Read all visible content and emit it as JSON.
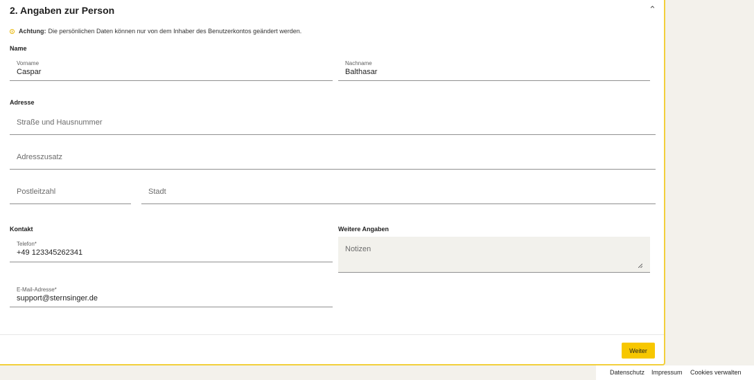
{
  "section": {
    "title": "2. Angaben zur Person",
    "warning_bold": "Achtung:",
    "warning_text": "Die persönlichen Daten können nur von dem Inhaber des Benutzerkontos geändert werden."
  },
  "name": {
    "label": "Name",
    "first_label": "Vorname",
    "first_value": "Caspar",
    "last_label": "Nachname",
    "last_value": "Balthasar"
  },
  "address": {
    "label": "Adresse",
    "street_placeholder": "Straße und Hausnummer",
    "extra_placeholder": "Adresszusatz",
    "zip_placeholder": "Postleitzahl",
    "city_placeholder": "Stadt"
  },
  "contact": {
    "label": "Kontakt",
    "phone_label": "Telefon*",
    "phone_value": "+49 123345262341",
    "email_label": "E-Mail-Adresse*",
    "email_value": "support@sternsinger.de"
  },
  "more": {
    "label": "Weitere Angaben",
    "notes_placeholder": "Notizen"
  },
  "actions": {
    "next_label": "Weiter"
  },
  "footer": {
    "links": [
      "Datenschutz",
      "Impressum",
      "Cookies verwalten"
    ]
  },
  "colors": {
    "accent": "#f7c700",
    "border": "#f2cf3a",
    "page_bg": "#f3f1eb"
  }
}
